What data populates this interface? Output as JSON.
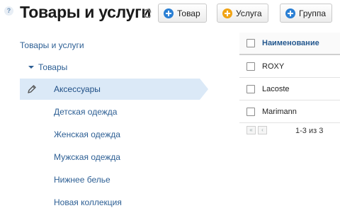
{
  "header": {
    "help": "?",
    "title": "Товары и услуги",
    "buttons": [
      {
        "label": "Товар",
        "color": "#2a7fd4"
      },
      {
        "label": "Услуга",
        "color": "#f0a314"
      },
      {
        "label": "Группа",
        "color": "#2a7fd4"
      }
    ]
  },
  "tree": {
    "root": "Товары и услуги",
    "group": "Товары",
    "items": [
      {
        "label": "Аксессуары",
        "selected": true
      },
      {
        "label": "Детская одежда"
      },
      {
        "label": "Женская одежда"
      },
      {
        "label": "Мужская одежда"
      },
      {
        "label": "Нижнее белье"
      },
      {
        "label": "Новая коллекция"
      }
    ]
  },
  "table": {
    "column": "Наименование",
    "rows": [
      "ROXY",
      "Lacoste",
      "Marimann"
    ],
    "pager": "1-3 из 3",
    "pager_first": "«",
    "pager_prev": "‹"
  }
}
